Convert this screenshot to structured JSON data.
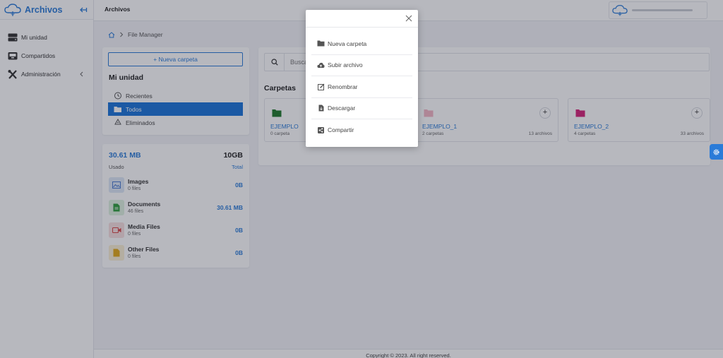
{
  "sidebar": {
    "brand": "Archivos",
    "items": [
      {
        "label": "Mi unidad",
        "icon": "drive-icon"
      },
      {
        "label": "Compartidos",
        "icon": "shared-inbox-icon"
      },
      {
        "label": "Administración",
        "icon": "tools-icon"
      }
    ]
  },
  "topbar": {
    "title": "Archivos"
  },
  "breadcrumb": {
    "current": "File Manager"
  },
  "left_panel": {
    "new_folder_label": "+ Nueva carpeta",
    "heading": "Mi unidad",
    "items": [
      {
        "label": "Recientes",
        "icon": "recent-icon"
      },
      {
        "label": "Todos",
        "icon": "folder-open-icon",
        "active": true
      },
      {
        "label": "Eliminados",
        "icon": "recycle-icon"
      }
    ]
  },
  "storage": {
    "used_value": "30.61 MB",
    "used_label": "Usado",
    "total_value": "10GB",
    "total_label": "Total",
    "types": [
      {
        "name": "Images",
        "count": "0 files",
        "size": "0B",
        "icon": "image-icon",
        "color": "#4a7bd0",
        "bg": "#dde8f7"
      },
      {
        "name": "Documents",
        "count": "46 files",
        "size": "30.61 MB",
        "icon": "document-icon",
        "color": "#2e9e3c",
        "bg": "#dff2e1"
      },
      {
        "name": "Media Files",
        "count": "0 files",
        "size": "0B",
        "icon": "video-icon",
        "color": "#d94848",
        "bg": "#f8e0e0"
      },
      {
        "name": "Other Files",
        "count": "0 files",
        "size": "0B",
        "icon": "file-icon",
        "color": "#e3a817",
        "bg": "#fbf0d5"
      }
    ]
  },
  "main": {
    "search_placeholder": "Buscar",
    "section_title": "Carpetas",
    "folders": [
      {
        "name": "EJEMPLO",
        "subtitle": "0 carpeta",
        "files": "",
        "color": "#1e7a2a"
      },
      {
        "name": "EJEMPLO_1",
        "subtitle": "2 carpetas",
        "files": "13 archivos",
        "color": "#f3b6c4"
      },
      {
        "name": "EJEMPLO_2",
        "subtitle": "4 carpetas",
        "files": "33 archivos",
        "color": "#d6237a"
      }
    ]
  },
  "modal": {
    "items": [
      {
        "label": "Nueva carpeta",
        "icon": "folder-icon"
      },
      {
        "label": "Subir archivo",
        "icon": "cloud-upload-icon"
      },
      {
        "label": "Renombrar",
        "icon": "edit-icon"
      },
      {
        "label": "Descargar",
        "icon": "download-file-icon"
      },
      {
        "label": "Compartir",
        "icon": "share-icon"
      }
    ]
  },
  "footer": {
    "text": "Copyright © 2023. All right reserved."
  },
  "colors": {
    "accent": "#2a7bd8",
    "active": "#1a73d9"
  }
}
